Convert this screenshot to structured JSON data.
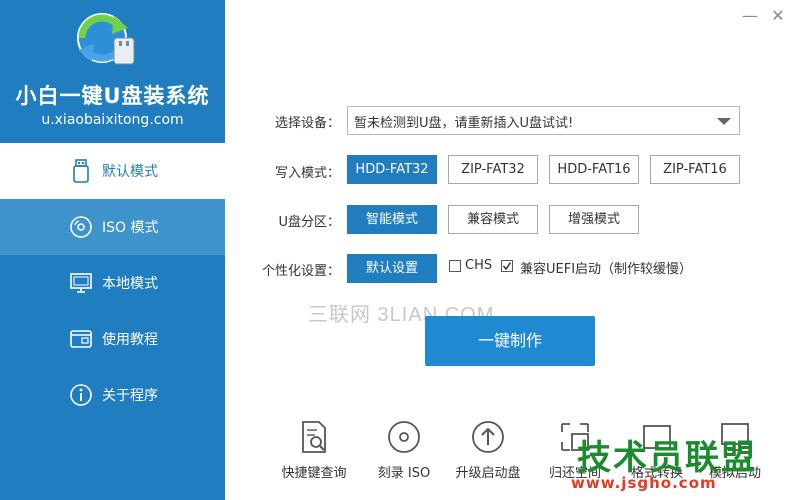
{
  "app": {
    "title": "小白一键U盘装系统",
    "url": "u.xiaobaixitong.com"
  },
  "sidebar": {
    "items": [
      {
        "label": "默认模式",
        "icon": "usb-drive-icon"
      },
      {
        "label": "ISO 模式",
        "icon": "disc-icon"
      },
      {
        "label": "本地模式",
        "icon": "monitor-icon"
      },
      {
        "label": "使用教程",
        "icon": "book-icon"
      },
      {
        "label": "关于程序",
        "icon": "info-icon"
      }
    ]
  },
  "window": {
    "minimize": "—",
    "close": "✕"
  },
  "form": {
    "device_label": "选择设备：",
    "device_value": "暂未检测到U盘，请重新插入U盘试试!",
    "write_mode_label": "写入模式：",
    "write_modes": [
      "HDD-FAT32",
      "ZIP-FAT32",
      "HDD-FAT16",
      "ZIP-FAT16"
    ],
    "partition_label": "U盘分区：",
    "partition_modes": [
      "智能模式",
      "兼容模式",
      "增强模式"
    ],
    "custom_label": "个性化设置：",
    "default_settings": "默认设置",
    "chs_label": "CHS",
    "uefi_label": "兼容UEFI启动（制作较缓慢）",
    "chs_checked": false,
    "uefi_checked": true
  },
  "watermark": "三联网 3LIAN.COM",
  "action": {
    "make_label": "一键制作"
  },
  "tools": [
    {
      "label": "快捷键查询",
      "icon": "search-document-icon"
    },
    {
      "label": "刻录 ISO",
      "icon": "burn-disc-icon"
    },
    {
      "label": "升级启动盘",
      "icon": "upgrade-arrow-icon"
    },
    {
      "label": "归还空间",
      "icon": "restore-space-icon"
    },
    {
      "label": "格式转换",
      "icon": "convert-icon"
    },
    {
      "label": "模拟启动",
      "icon": "simulate-boot-icon"
    }
  ],
  "brand": {
    "name": "技术员联盟",
    "site": "www.jsgho.com"
  },
  "colors": {
    "primary": "#1f7dc0",
    "selected": "#1f7dc0",
    "brand_green": "#1a8c2e",
    "brand_red": "#e23b25"
  }
}
